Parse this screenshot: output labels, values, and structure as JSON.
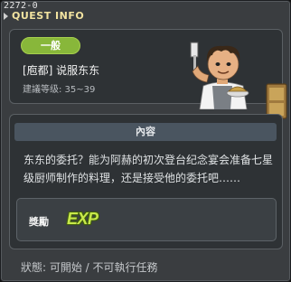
{
  "window": {
    "quest_id": "2272-0",
    "title": "QUEST INFO"
  },
  "quest": {
    "category": "一般",
    "name": "[庖都] 说服东东",
    "level": "建議等级: 35~39"
  },
  "content": {
    "title": "內容",
    "text": "东东的委托？能为阿赫的初次登台纪念宴会准备七星级厨师制作的料理，还是接受他的委托吧……"
  },
  "reward": {
    "label": "獎勵",
    "exp_text": "EXP"
  },
  "status": {
    "text": "狀態: 可開始 / 不可執行任務"
  },
  "icons": {
    "npc": "chef-npc-portrait",
    "sign": "wooden-sign-board",
    "exp": "exp-icon"
  },
  "colors": {
    "category_badge": "#88b73a",
    "header_title": "#f2e3a0",
    "exp": "#c7e84a"
  }
}
